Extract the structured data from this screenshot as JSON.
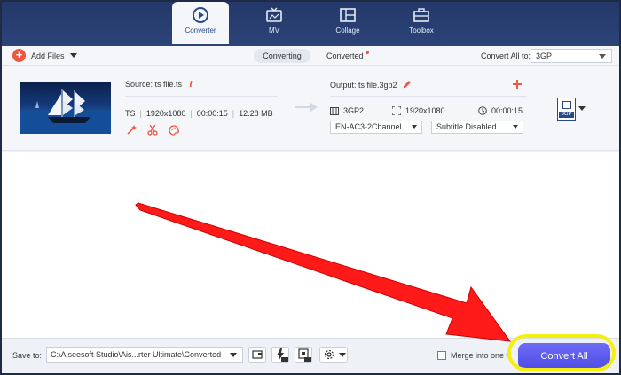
{
  "nav": {
    "tabs": [
      {
        "label": "Converter",
        "icon": "converter-icon",
        "active": true
      },
      {
        "label": "MV",
        "icon": "tv-icon"
      },
      {
        "label": "Collage",
        "icon": "collage-icon"
      },
      {
        "label": "Toolbox",
        "icon": "toolbox-icon"
      }
    ]
  },
  "toolbar": {
    "add_files": "Add Files",
    "converting": "Converting",
    "converted": "Converted",
    "convert_all_to": "Convert All to:",
    "format": "3GP"
  },
  "file": {
    "source_label": "Source: ts file.ts",
    "format": "TS",
    "resolution": "1920x1080",
    "duration": "00:00:15",
    "size": "12.28 MB",
    "output_label": "Output: ts file.3gp2",
    "out_format": "3GP2",
    "out_resolution": "1920x1080",
    "out_duration": "00:00:15",
    "audio_track": "EN-AC3-2Channel",
    "subtitle": "Subtitle Disabled",
    "badge": "3GP"
  },
  "bottom": {
    "save_to": "Save to:",
    "save_path": "C:\\Aiseesoft Studio\\Ais...rter Ultimate\\Converted",
    "merge_label": "Merge into one fi",
    "convert_all": "Convert All"
  },
  "colors": {
    "accent": "#f0573e",
    "button": "#5553ea",
    "highlight": "#f5ee12",
    "arrow": "#ff1a1a"
  }
}
